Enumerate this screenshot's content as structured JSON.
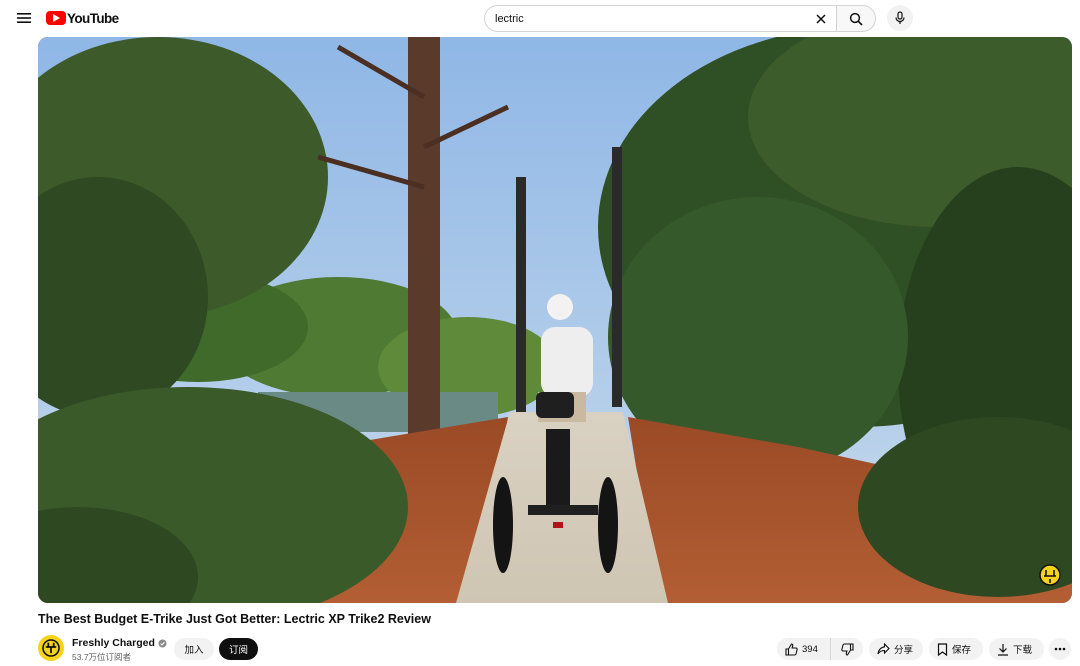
{
  "header": {
    "logo_text": "YouTube",
    "search": {
      "value": "lectric"
    },
    "icons": {
      "menu": "hamburger-menu-icon",
      "clear": "close-icon",
      "search": "search-icon",
      "mic": "microphone-icon"
    }
  },
  "video": {
    "title": "The Best Budget E-Trike Just Got Better: Lectric XP Trike2 Review",
    "thumbnail": "scene-rider-on-electric-trike-on-bridge-in-park"
  },
  "channel": {
    "name": "Freshly Charged",
    "subscribers": "53.7万位订阅者",
    "verified_icon": "verified-check-icon"
  },
  "actions": {
    "join_label": "加入",
    "subscribe_label": "订阅",
    "like_count": "394",
    "share_label": "分享",
    "save_label": "保存",
    "download_label": "下载"
  },
  "colors": {
    "brand_red": "#ff0000",
    "subscribe_bg": "#0f0f0f",
    "pill_bg": "#f2f2f2",
    "channel_avatar_bg": "#f6d31b"
  }
}
